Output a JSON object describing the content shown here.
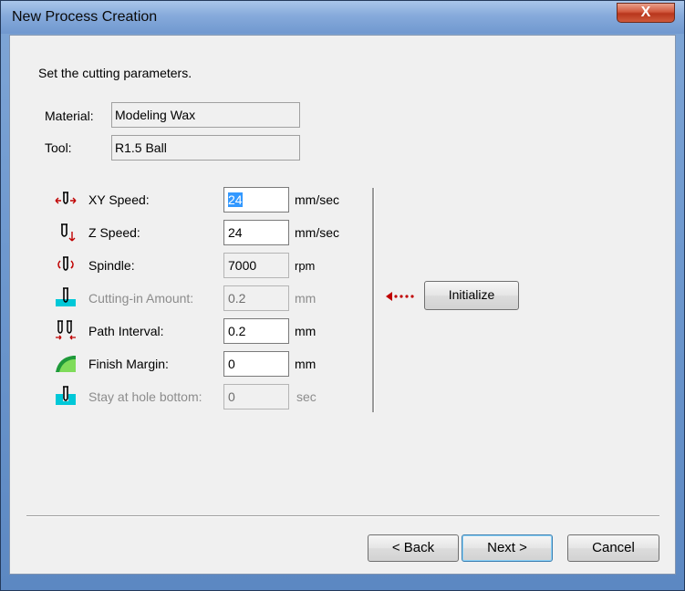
{
  "window": {
    "title": "New Process Creation",
    "close_symbol": "X"
  },
  "intro": "Set the cutting parameters.",
  "material": {
    "label": "Material:",
    "value": "Modeling Wax"
  },
  "tool": {
    "label": "Tool:",
    "value": "R1.5 Ball"
  },
  "params": {
    "xy_speed": {
      "label": "XY Speed:",
      "value": "24",
      "unit": "mm/sec"
    },
    "z_speed": {
      "label": "Z Speed:",
      "value": "24",
      "unit": "mm/sec"
    },
    "spindle": {
      "label": "Spindle:",
      "value": "7000",
      "unit": "rpm"
    },
    "cutting_in": {
      "label": "Cutting-in Amount:",
      "value": "0.2",
      "unit": "mm"
    },
    "path_interval": {
      "label": "Path Interval:",
      "value": "0.2",
      "unit": "mm"
    },
    "finish_margin": {
      "label": "Finish Margin:",
      "value": "0",
      "unit": "mm"
    },
    "stay_hole": {
      "label": "Stay at hole bottom:",
      "value": "0",
      "unit": "sec"
    }
  },
  "initialize_label": "Initialize",
  "buttons": {
    "back": "< Back",
    "next": "Next >",
    "cancel": "Cancel"
  },
  "icons": {
    "xy_speed": "xy-speed-icon",
    "z_speed": "z-speed-icon",
    "spindle": "spindle-icon",
    "cutting_in": "cutting-in-icon",
    "path_interval": "path-interval-icon",
    "finish_margin": "finish-margin-icon",
    "stay_hole": "stay-hole-icon",
    "arrow": "dotted-arrow-left-icon"
  },
  "colors": {
    "selection": "#3399ff",
    "arrow": "#c00000",
    "cyan": "#00c8d8"
  }
}
